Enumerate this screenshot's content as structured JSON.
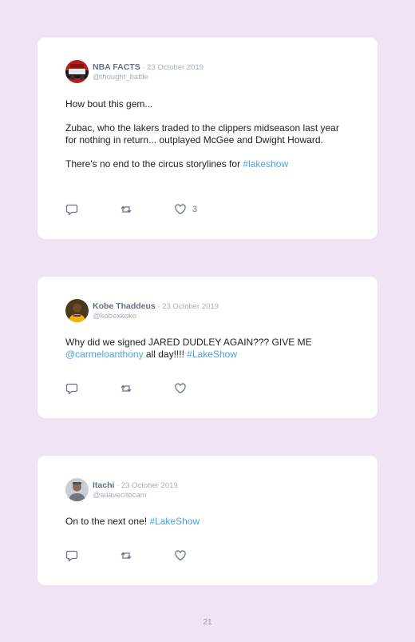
{
  "page": {
    "number": "21",
    "background": "#f0e4f4",
    "hashtag_color": "#4aa3df"
  },
  "icons": {
    "reply": "reply-icon",
    "retweet": "retweet-icon",
    "like": "heart-icon"
  },
  "tweets": [
    {
      "name": "NBA FACTS",
      "sep": " · ",
      "date": "23 October 2019",
      "handle": "@thought_battle",
      "avatar_icon": "team-logo-avatar",
      "p1": "How bout this gem...",
      "p2": "Zubac, who the lakers traded to the clippers midseason last year for nothing in return... outplayed McGee and Dwight Howard.",
      "p3_text": "There's no end to the circus storylines for ",
      "p3_tag": "#lakeshow",
      "likes": "3"
    },
    {
      "name": "Kobe Thaddeus",
      "sep": " · ",
      "date": "23 October 2019",
      "handle": "@kobexkoko",
      "avatar_icon": "player-photo-avatar",
      "text1": "Why did we signed JARED DUDLEY AGAIN??? GIVE ME ",
      "mention": "@carmeloanthony",
      "text2": " all day!!!! ",
      "tag": "#LakeShow"
    },
    {
      "name": "Itachi",
      "sep": " · ",
      "date": "23 October 2019",
      "handle": "@suavecitocam",
      "avatar_icon": "person-photo-avatar",
      "text1": "On to the next one! ",
      "tag": "#LakeShow"
    }
  ]
}
